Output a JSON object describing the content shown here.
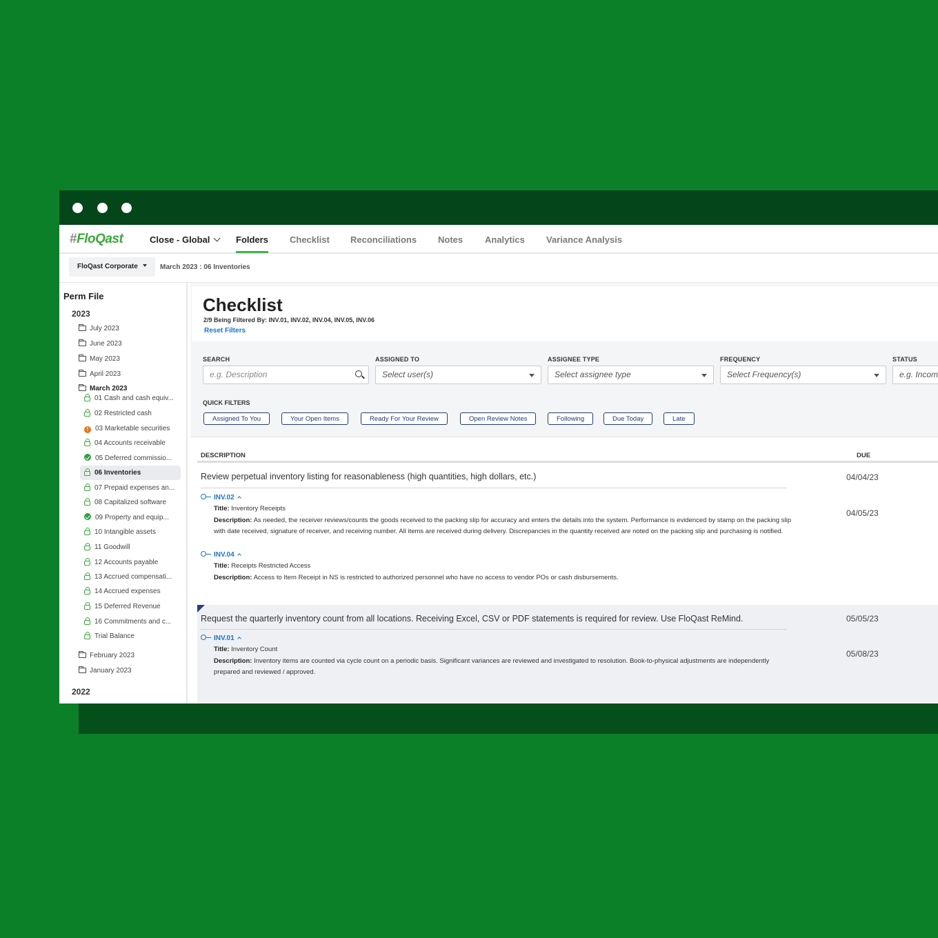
{
  "nav": {
    "logo": "FloQast",
    "workspace": "Close - Global",
    "tabs": [
      "Folders",
      "Checklist",
      "Reconciliations",
      "Notes",
      "Analytics",
      "Variance Analysis"
    ],
    "active_tab": "Folders"
  },
  "subbar": {
    "entity": "FloQast Corporate",
    "breadcrumb": "March 2023 : 06 Inventories"
  },
  "sidebar": {
    "title": "Perm File",
    "year_current": "2023",
    "year_prev": "2022",
    "folders_top": [
      "July 2023",
      "June 2023",
      "May 2023",
      "April 2023"
    ],
    "open_folder": "March 2023",
    "items": [
      {
        "label": "01 Cash and cash equiv...",
        "status": "lock"
      },
      {
        "label": "02 Restricted cash",
        "status": "lock"
      },
      {
        "label": "03 Marketable securities",
        "status": "warning"
      },
      {
        "label": "04 Accounts receivable",
        "status": "lock"
      },
      {
        "label": "05 Deferred commissio...",
        "status": "complete"
      },
      {
        "label": "06 Inventories",
        "status": "lock"
      },
      {
        "label": "07 Prepaid expenses an...",
        "status": "lock"
      },
      {
        "label": "08 Capitalized software",
        "status": "lock"
      },
      {
        "label": "09 Property and equip...",
        "status": "complete"
      },
      {
        "label": "10 Intangible assets",
        "status": "lock"
      },
      {
        "label": "11 Goodwill",
        "status": "lock"
      },
      {
        "label": "12 Accounts payable",
        "status": "lock"
      },
      {
        "label": "13 Accrued compensati...",
        "status": "lock"
      },
      {
        "label": "14 Accrued expenses",
        "status": "lock"
      },
      {
        "label": "15 Deferred Revenue",
        "status": "lock"
      },
      {
        "label": "16 Commitments and c...",
        "status": "lock"
      },
      {
        "label": "Trial Balance",
        "status": "lock"
      }
    ],
    "folders_bottom": [
      "February 2023",
      "January 2023"
    ]
  },
  "checklist": {
    "title": "Checklist",
    "filter_text": "2/9 Being Filtered By: INV.01, INV.02, INV.04, INV.05, INV.06",
    "reset_label": "Reset Filters"
  },
  "filters": {
    "search_label": "SEARCH",
    "search_placeholder": "e.g. Description",
    "assigned_label": "ASSIGNED TO",
    "assigned_value": "Select user(s)",
    "assignee_type_label": "ASSIGNEE TYPE",
    "assignee_type_value": "Select assignee type",
    "frequency_label": "FREQUENCY",
    "frequency_value": "Select Frequency(s)",
    "status_label": "STATUS",
    "status_value": "e.g. Incom",
    "quick_label": "QUICK FILTERS",
    "quick": [
      "Assigned To You",
      "Your Open Items",
      "Ready For Your Review",
      "Open Review Notes",
      "Following",
      "Due Today",
      "Late"
    ]
  },
  "table": {
    "col_description": "DESCRIPTION",
    "col_due": "DUE",
    "rows": [
      {
        "description": "Review perpetual inventory listing for reasonableness (high quantities, high dollars, etc.)",
        "due": [
          "04/04/23",
          "04/05/23"
        ],
        "controls": [
          {
            "code": "INV.02",
            "title": "Inventory Receipts",
            "description": "As needed, the receiver reviews/counts the goods received to the packing slip for accuracy and enters the details into the system. Performance is evidenced by stamp on the packing slip with date received, signature of receiver, and receiving number. All items are received during delivery. Discrepancies in the quantity received are noted on the packing slip and purchasing is notified."
          },
          {
            "code": "INV.04",
            "title": "Receipts Restricted Access",
            "description": "Access to Item Receipt in NS is restricted to authorized personnel who have no access to vendor POs or cash disbursements."
          }
        ]
      },
      {
        "description": "Request the quarterly inventory count from all locations. Receiving Excel, CSV or PDF statements is required for review. Use FloQast ReMind.",
        "due": [
          "05/05/23",
          "05/08/23"
        ],
        "controls": [
          {
            "code": "INV.01",
            "title": "Inventory Count",
            "description": "Inventory items are counted via cycle count on a periodic basis. Significant variances are reviewed and investigated to resolution. Book-to-physical adjustments are independently prepared and reviewed / approved."
          }
        ]
      }
    ],
    "title_prefix": "Title:",
    "desc_prefix": "Description:"
  },
  "colors": {
    "background": "#0b8029",
    "titlebar": "#04451a",
    "brand_green": "#3aa93a",
    "link_blue": "#1a73c7",
    "quick_filter_border": "#1f3b73",
    "warning": "#e8731a"
  }
}
